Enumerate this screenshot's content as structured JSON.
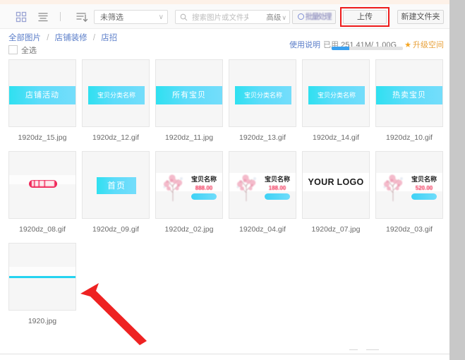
{
  "toolbar": {
    "grid_view_icon": "grid-icon",
    "list_view_icon": "list-icon",
    "sort_icon": "sort-icon",
    "filter_value": "未筛选",
    "filter_caret": "∨",
    "search_placeholder": "搜索图片或文件夹",
    "search_value": "",
    "search_icon": "search-icon",
    "advanced_label": "高级",
    "advanced_caret": "∨",
    "batch_label": "批量处理",
    "upload_label": "上传",
    "new_folder_label": "新建文件夹"
  },
  "breadcrumb": {
    "root": "全部图片",
    "sep": "/",
    "level2": "店铺装修",
    "current": "店招"
  },
  "storage": {
    "help_label": "使用说明",
    "usage_prefix": "已用",
    "usage_value": "251.41M/ 1.00G",
    "upgrade_label": "升级空间",
    "star_icon": "★",
    "used_percent": 25
  },
  "select_all": {
    "label": "全选",
    "checked": false
  },
  "files": [
    {
      "name": "1920dz_15.jpg",
      "style": "band",
      "text": "店铺活动"
    },
    {
      "name": "1920dz_12.gif",
      "style": "band-sm",
      "text": "宝贝分类名称"
    },
    {
      "name": "1920dz_11.jpg",
      "style": "band",
      "text": "所有宝贝"
    },
    {
      "name": "1920dz_13.gif",
      "style": "band-sm",
      "text": "宝贝分类名称"
    },
    {
      "name": "1920dz_14.gif",
      "style": "band-sm",
      "text": "宝贝分类名称"
    },
    {
      "name": "1920dz_10.gif",
      "style": "band",
      "text": "热卖宝贝"
    },
    {
      "name": "1920dz_08.gif",
      "style": "pill",
      "text": ""
    },
    {
      "name": "1920dz_09.gif",
      "style": "button",
      "text": "首页"
    },
    {
      "name": "1920dz_02.jpg",
      "style": "product",
      "text": "宝贝名称",
      "price": "888.00"
    },
    {
      "name": "1920dz_04.gif",
      "style": "product",
      "text": "宝贝名称",
      "price": "188.00"
    },
    {
      "name": "1920dz_07.jpg",
      "style": "logo",
      "text": "YOUR LOGO"
    },
    {
      "name": "1920dz_03.gif",
      "style": "product",
      "text": "宝贝名称",
      "price": "520.00"
    },
    {
      "name": "1920.jpg",
      "style": "line",
      "text": ""
    }
  ],
  "annotation": {
    "arrow_color": "#ee2222",
    "highlight_color": "#ee1b1b",
    "highlight_target": "上传"
  }
}
